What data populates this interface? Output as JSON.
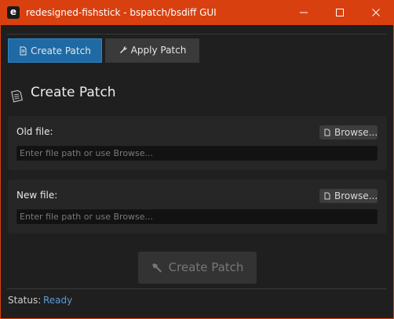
{
  "window": {
    "title": "redesigned-fishstick - bspatch/bsdiff GUI",
    "app_icon_letter": "e"
  },
  "tabs": [
    {
      "label": "Create Patch",
      "icon": "document-icon",
      "selected": true
    },
    {
      "label": "Apply Patch",
      "icon": "wrench-icon",
      "selected": false
    }
  ],
  "section": {
    "title": "Create Patch",
    "icon": "document-icon"
  },
  "old_file": {
    "label": "Old file:",
    "browse_label": "Browse...",
    "value": "",
    "placeholder": "Enter file path or use Browse..."
  },
  "new_file": {
    "label": "New file:",
    "browse_label": "Browse...",
    "value": "",
    "placeholder": "Enter file path or use Browse..."
  },
  "action": {
    "label": "Create Patch",
    "icon": "hammer-icon",
    "enabled": false
  },
  "status": {
    "label": "Status:",
    "value": "Ready"
  },
  "colors": {
    "titlebar": "#d9400f",
    "accent": "#1f6aa5",
    "status_ready": "#5a9bd6",
    "background": "#1f1f1f"
  }
}
